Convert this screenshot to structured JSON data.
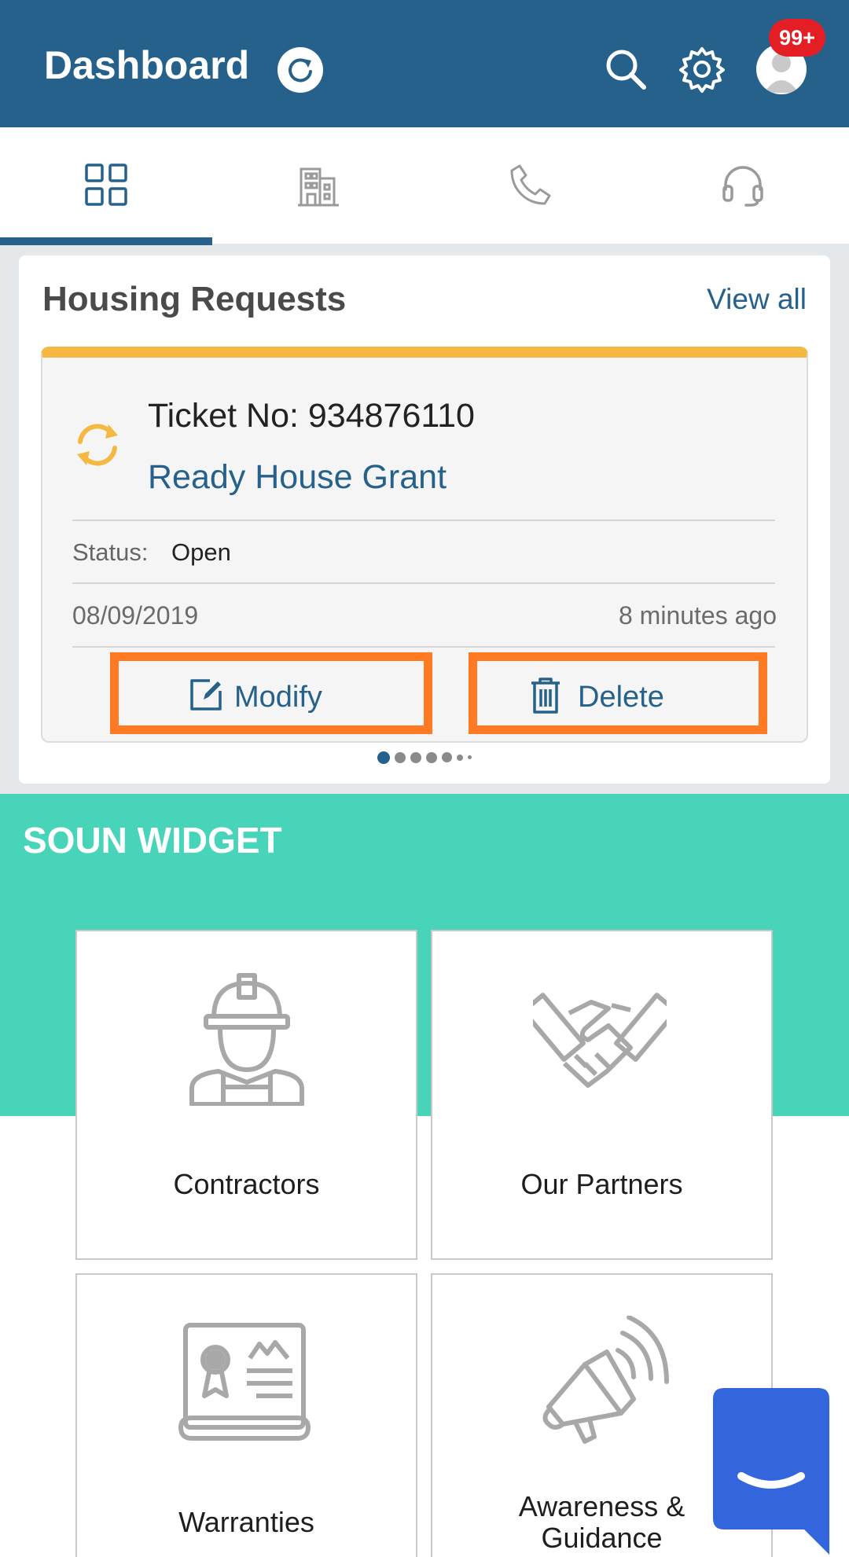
{
  "header": {
    "title": "Dashboard",
    "notification_badge": "99+",
    "icons": [
      "refresh-icon",
      "search-icon",
      "gear-icon",
      "user-avatar-icon"
    ],
    "background_color": "#26618c"
  },
  "tabs": [
    {
      "name": "dashboard",
      "icon": "grid-icon",
      "selected": true
    },
    {
      "name": "buildings",
      "icon": "building-icon",
      "selected": false
    },
    {
      "name": "call",
      "icon": "phone-icon",
      "selected": false
    },
    {
      "name": "support",
      "icon": "headset-icon",
      "selected": false
    }
  ],
  "housing_requests": {
    "title": "Housing Requests",
    "view_all": "View all",
    "ticket": {
      "number_label": "Ticket No: 934876110",
      "type": "Ready House Grant",
      "status_label": "Status:",
      "status_value": "Open",
      "date": "08/09/2019",
      "relative_time": "8 minutes ago",
      "accent_color": "#f5b942"
    },
    "actions": {
      "modify": "Modify",
      "delete": "Delete"
    },
    "pagination": {
      "pages": 7,
      "active_index": 0
    }
  },
  "widget": {
    "title": "SOUN WIDGET",
    "background_color": "#48d4b8",
    "tiles": [
      {
        "label": "Contractors",
        "icon": "worker-icon"
      },
      {
        "label": "Our Partners",
        "icon": "handshake-icon"
      },
      {
        "label": "Warranties",
        "icon": "certificate-icon"
      },
      {
        "label_line1": "Awareness &",
        "label_line2": "Guidance",
        "icon": "megaphone-icon"
      }
    ]
  },
  "chat": {
    "icon": "chat-smile-icon",
    "color": "#3366dd"
  }
}
